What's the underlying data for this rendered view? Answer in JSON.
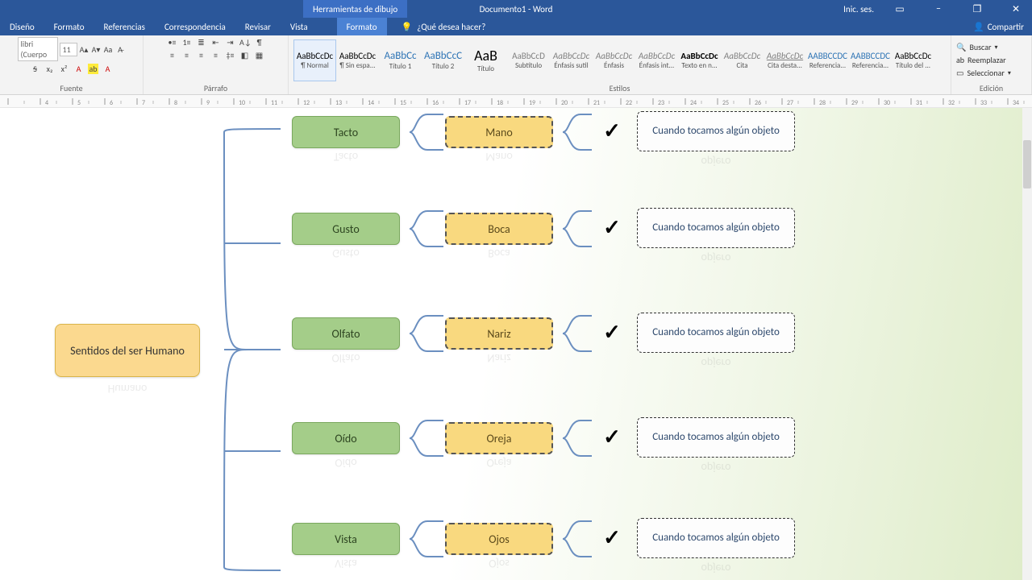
{
  "titlebar": {
    "contextual": "Herramientas de dibujo",
    "title": "Documento1 - Word",
    "login": "Inic. ses.",
    "minimize": "–",
    "maximize": "❐",
    "close": "✕",
    "ribbon_opts": "▭"
  },
  "tabs": {
    "items": [
      "Diseño",
      "Formato",
      "Referencias",
      "Correspondencia",
      "Revisar",
      "Vista"
    ],
    "contextual": "Formato",
    "tell_me_placeholder": "¿Qué desea hacer?",
    "share": "Compartir"
  },
  "ribbon": {
    "font": {
      "name": "libri (Cuerpo",
      "size": "11",
      "label": "Fuente"
    },
    "para": {
      "label": "Párrafo"
    },
    "styles": {
      "label": "Estilos",
      "items": [
        {
          "sample": "AaBbCcDc",
          "name": "¶ Normal"
        },
        {
          "sample": "AaBbCcDc",
          "name": "¶ Sin espa..."
        },
        {
          "sample": "AaBbCc",
          "name": "Título 1"
        },
        {
          "sample": "AaBbCcC",
          "name": "Título 2"
        },
        {
          "sample": "AaB",
          "name": "Título"
        },
        {
          "sample": "AaBbCcD",
          "name": "Subtítulo"
        },
        {
          "sample": "AaBbCcDc",
          "name": "Énfasis sutil"
        },
        {
          "sample": "AaBbCcDc",
          "name": "Énfasis"
        },
        {
          "sample": "AaBbCcDc",
          "name": "Énfasis int..."
        },
        {
          "sample": "AaBbCcDc",
          "name": "Texto en n..."
        },
        {
          "sample": "AaBbCcDc",
          "name": "Cita"
        },
        {
          "sample": "AaBbCcDc",
          "name": "Cita desta..."
        },
        {
          "sample": "AABBCCDC",
          "name": "Referencia..."
        },
        {
          "sample": "AABBCCDC",
          "name": "Referencia..."
        },
        {
          "sample": "AaBbCcDc",
          "name": "Título del ..."
        }
      ]
    },
    "editing": {
      "label": "Edición",
      "find": "Buscar",
      "replace": "Reemplazar",
      "select": "Seleccionar"
    }
  },
  "diagram": {
    "root": "Sentidos del ser Humano",
    "rows": [
      {
        "sense": "Tacto",
        "organ": "Mano",
        "desc": "Cuando tocamos algún objeto"
      },
      {
        "sense": "Gusto",
        "organ": "Boca",
        "desc": "Cuando tocamos algún objeto"
      },
      {
        "sense": "Olfato",
        "organ": "Nariz",
        "desc": "Cuando tocamos algún objeto"
      },
      {
        "sense": "Oído",
        "organ": "Oreja",
        "desc": "Cuando tocamos algún objeto"
      },
      {
        "sense": "Vista",
        "organ": "Ojos",
        "desc": "Cuando tocamos algún objeto"
      }
    ],
    "check": "✓",
    "reflection": "opjero"
  }
}
